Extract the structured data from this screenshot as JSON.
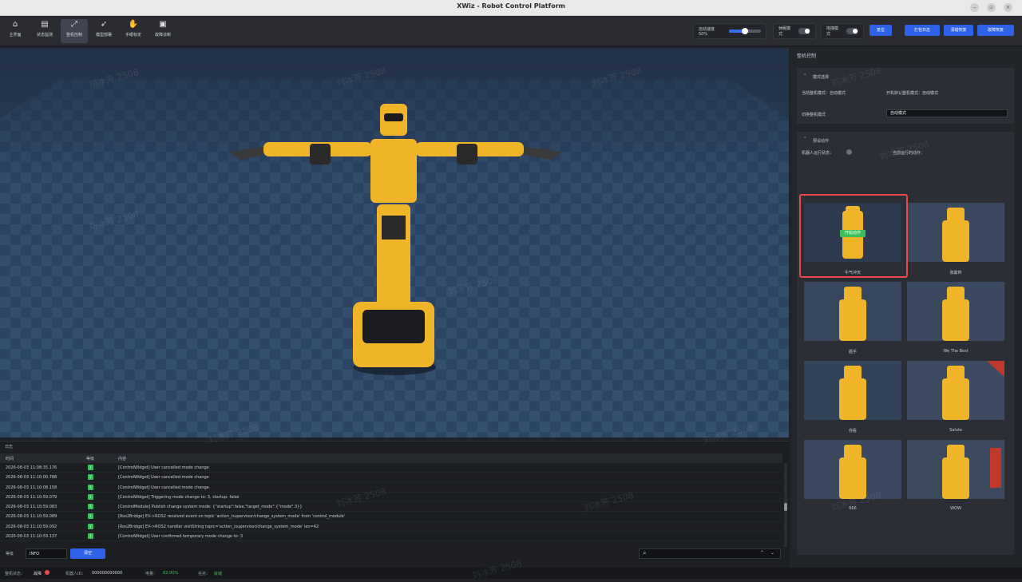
{
  "window": {
    "title": "XWiz - Robot Control Platform"
  },
  "nav": [
    {
      "label": "主界面",
      "icon": "home-icon"
    },
    {
      "label": "状态监测",
      "icon": "monitor-icon"
    },
    {
      "label": "整机控制",
      "icon": "control-icon"
    },
    {
      "label": "模型部署",
      "icon": "rocket-icon"
    },
    {
      "label": "手眼标定",
      "icon": "hand-icon"
    },
    {
      "label": "故障诊断",
      "icon": "diagnosis-icon"
    }
  ],
  "toolbar": {
    "speed_label": "自动速度 50%",
    "speed_value": 0.5,
    "dormant_label": "休眠模式",
    "drag_label": "拖拽模式",
    "reset_label": "复位",
    "open_log_label": "打包日志",
    "clear_error_label": "清错恢复",
    "fault_recover_label": "故障恢复"
  },
  "right_panel": {
    "title": "整机控制",
    "mode_section": {
      "title": "模式选择",
      "current_mode": "当前整机模式：自动模式",
      "default_mode": "开机默认整机模式：自动模式",
      "switch_label": "切换整机模式",
      "switch_value": "自动模式"
    },
    "action_section": {
      "title": "预设动作",
      "robot_running": "机器人运行状态：",
      "current_action": "当前运行的动作："
    },
    "start_badge": "开始动作",
    "actions": [
      {
        "label": "牛气冲天"
      },
      {
        "label": "我最帅"
      },
      {
        "label": "握手"
      },
      {
        "label": "We The Best"
      },
      {
        "label": "你看"
      },
      {
        "label": "Salute"
      },
      {
        "label": "666"
      },
      {
        "label": "WOW"
      }
    ]
  },
  "log": {
    "title": "日志",
    "columns": {
      "time": "时间",
      "level": "等级",
      "content": "内容"
    },
    "rows": [
      {
        "time": "2026-08-03 11:08:35.176",
        "level": "I",
        "content": "[ControlWidget] User cancelled mode change"
      },
      {
        "time": "2026-08-03 11:10:00.788",
        "level": "I",
        "content": "[ControlWidget] User cancelled mode change"
      },
      {
        "time": "2026-08-03 11:10:08.158",
        "level": "I",
        "content": "[ControlWidget] User cancelled mode change"
      },
      {
        "time": "2026-08-03 11:10:59.079",
        "level": "I",
        "content": "[ControlWidget] Triggering mode change to: 3, startup: false"
      },
      {
        "time": "2026-08-03 11:10:59.083",
        "level": "I",
        "content": "[ControlModule] Publish change system mode: {\"startup\":false,\"target_mode\":{\"mode\":3}}"
      },
      {
        "time": "2026-08-03 11:10:59.089",
        "level": "I",
        "content": "[Ros2Bridge] EV->ROS2 received event on topic 'action_/supervisor/change_system_mode' from 'control_module'"
      },
      {
        "time": "2026-08-03 11:10:59.092",
        "level": "I",
        "content": "[Ros2Bridge] EV->ROS2 handler visitString topic='action_/supervisor/change_system_mode' len=42"
      },
      {
        "time": "2026-08-03 11:10:59.137",
        "level": "I",
        "content": "[ControlWidget] User confirmed temporary mode change to: 3"
      }
    ],
    "level_label": "等级",
    "level_value": "INFO",
    "clear_label": "清空"
  },
  "status_bar": {
    "sys_state_label": "整机状态：",
    "sys_state_value": "故障",
    "robot_id_label": "机器人ID：",
    "robot_id_value": "000000000000",
    "battery_label": "电量：",
    "battery_value": "82.00%",
    "task_label": "任务：",
    "task_value": "就绪"
  },
  "watermark": "刘冰芳 2508",
  "colors": {
    "accent": "#2f62e8",
    "highlight": "#e84a4a",
    "ok": "#3cbf5a",
    "robot": "#f0b429"
  }
}
